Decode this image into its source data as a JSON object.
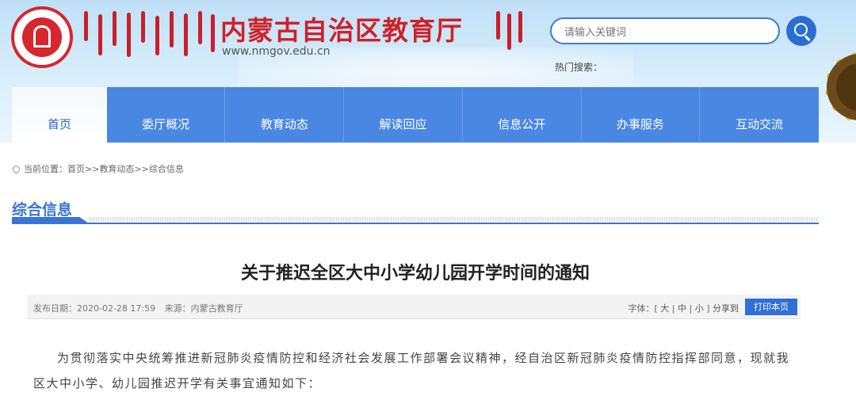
{
  "header": {
    "site_title": "内蒙古自治区教育厅",
    "site_url": "www.nmgov.edu.cn",
    "search_placeholder": "请输入关键词",
    "hot_search_label": "热门搜索："
  },
  "nav": {
    "items": [
      {
        "label": "首页",
        "active": true
      },
      {
        "label": "委厅概况"
      },
      {
        "label": "教育动态"
      },
      {
        "label": "解读回应"
      },
      {
        "label": "信息公开"
      },
      {
        "label": "办事服务"
      },
      {
        "label": "互动交流"
      }
    ]
  },
  "breadcrumb": {
    "prefix": "当前位置：",
    "home": "首页",
    "sep1": ">>",
    "level1": "教育动态",
    "sep2": ">>",
    "level2": "综合信息"
  },
  "section": {
    "title": "综合信息"
  },
  "article": {
    "title": "关于推迟全区大中小学幼儿园开学时间的通知",
    "publish_date": "发布日期：2020-02-28 17:59",
    "source": "来源：内蒙古教育厅",
    "font_label": "字体：[",
    "font_large": "大",
    "font_sep": "|",
    "font_medium": "中",
    "font_small": "小",
    "font_end": "]",
    "share_label": "分享到",
    "print_label": "打印本页",
    "paragraph": "为贯彻落实中央统筹推进新冠肺炎疫情防控和经济社会发展工作部署会议精神，经自治区新冠肺炎疫情防控指挥部同意，现就我区大中小学、幼儿园推迟开学有关事宜通知如下："
  },
  "colors": {
    "brand_red": "#d0202a",
    "nav_blue": "#4a87e3",
    "accent_blue": "#3a74d6",
    "button_blue": "#2f6fd6"
  }
}
